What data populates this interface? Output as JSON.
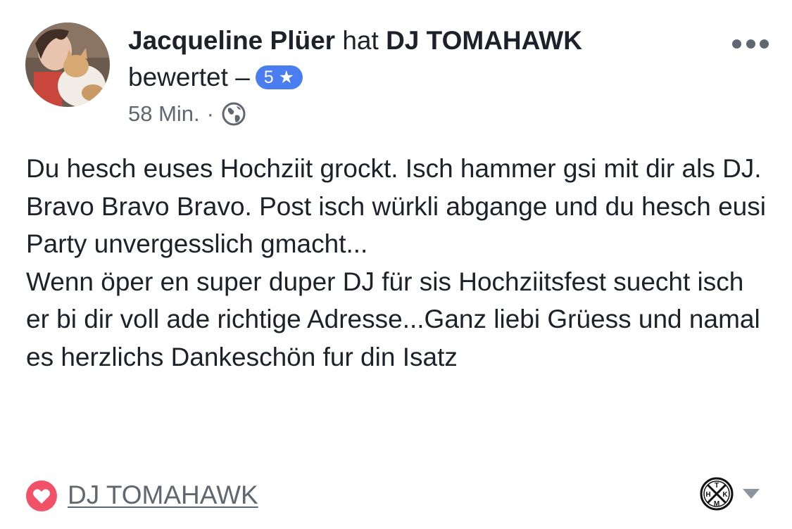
{
  "review": {
    "author_name": "Jacqueline Plüer",
    "action_word": "hat",
    "page_name": "DJ TOMAHAWK",
    "action_suffix": "bewertet –",
    "rating_value": "5",
    "rating_star": "★",
    "time_ago": "58 Min.",
    "separator": "·",
    "privacy_icon": "globe-icon",
    "more_icon": "ellipsis-icon",
    "body": {
      "paragraph_1": "Du hesch euses Hochziit grockt. Isch hammer gsi mit dir als DJ. Bravo Bravo Bravo. Post isch würkli abgange und du hesch eusi Party unvergesslich gmacht...",
      "paragraph_2": "Wenn öper en super duper DJ für sis Hochziitsfest suecht isch er bi dir voll ade richtige Adresse...Ganz liebi Grüess und namal es herzlichs Dankeschön fur din Isatz"
    }
  },
  "footer": {
    "reaction_icon": "heart-icon",
    "page_link_label": "DJ TOMAHAWK",
    "page_logo_letters": [
      "T",
      "K",
      "M",
      "H"
    ],
    "dropdown_icon": "chevron-down-icon"
  },
  "colors": {
    "rating_badge": "#4a7df0",
    "heart": "#f25268",
    "secondary_text": "#616770"
  }
}
